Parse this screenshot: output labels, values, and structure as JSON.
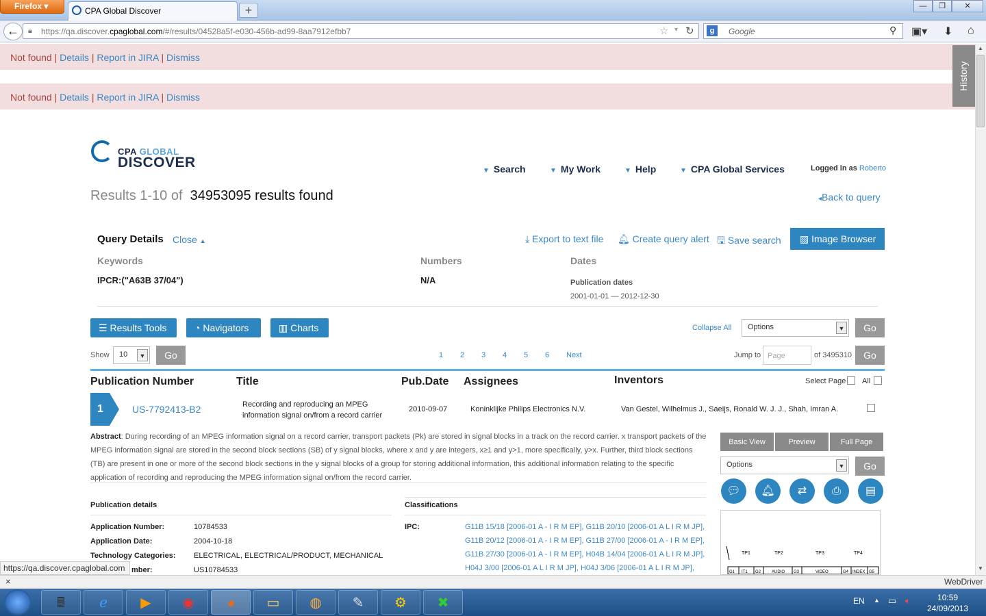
{
  "browser": {
    "menu_label": "Firefox",
    "tab_title": "CPA Global Discover",
    "new_tab": "+",
    "url_prefix": "https://qa.discover.",
    "url_domain": "cpaglobal.com",
    "url_rest": "/#/results/04528a5f-e030-456b-ad99-8aa7912efbb7",
    "search_placeholder": "Google",
    "status_url": "https://qa.discover.cpaglobal.com"
  },
  "alerts": [
    {
      "text": "Not found",
      "details": "Details",
      "jira": "Report in JIRA",
      "dismiss": "Dismiss"
    },
    {
      "text": "Not found",
      "details": "Details",
      "jira": "Report in JIRA",
      "dismiss": "Dismiss"
    }
  ],
  "history_tab": "History",
  "logo": {
    "cpa": "CPA",
    "global": "GLOBAL",
    "discover": "DISCOVER"
  },
  "menu": {
    "search": "Search",
    "mywork": "My Work",
    "help": "Help",
    "services": "CPA Global Services",
    "logged_in": "Logged in as",
    "user": "Roberto"
  },
  "results": {
    "prefix": "Results 1-10 of",
    "count": "34953095 results found",
    "back": "Back to query"
  },
  "query": {
    "title": "Query Details",
    "close": "Close",
    "export": "Export to text file",
    "alert": "Create query alert",
    "save": "Save search",
    "image_browser": "Image Browser",
    "keywords_label": "Keywords",
    "keywords_value": "IPCR:(\"A63B 37/04\")",
    "numbers_label": "Numbers",
    "numbers_value": "N/A",
    "dates_label": "Dates",
    "pubdates_label": "Publication dates",
    "pubdates_value": "2001-01-01 — 2012-12-30"
  },
  "tools": {
    "results_tools": "Results Tools",
    "navigators": "Navigators",
    "charts": "Charts",
    "collapse_all": "Collapse All",
    "options": "Options",
    "go": "Go",
    "show": "Show",
    "show_value": "10",
    "pages": [
      "1",
      "2",
      "3",
      "4",
      "5",
      "6"
    ],
    "next": "Next",
    "jump_to": "Jump to",
    "page_placeholder": "Page",
    "of_pages": "of 3495310"
  },
  "columns": {
    "pubnum": "Publication Number",
    "title": "Title",
    "pubdate": "Pub.Date",
    "assignees": "Assignees",
    "inventors": "Inventors",
    "select_page": "Select Page",
    "all": "All"
  },
  "result": {
    "index": "1",
    "pubnum": "US-7792413-B2",
    "title": "Recording and reproducing an MPEG information signal on/from a record carrier",
    "pubdate": "2010-09-07",
    "assignee": "Koninklijke Philips Electronics N.V.",
    "inventors": "Van Gestel, Wilhelmus J., Saeijs, Ronald W. J. J., Shah, Imran A.",
    "abstract_label": "Abstract",
    "abstract": ": During recording of an MPEG information signal on a record carrier, transport packets (Pk) are stored in signal blocks in a track on the record carrier. x transport packets of the MPEG information signal are stored in the second block sections (SB) of y signal blocks, where x and y are integers, x≥1 and y>1, more specifically, y>x. Further, third block sections (TB) are present in one or more of the second block sections in the y signal blocks of a group for storing additional information, this additional information relating to the specific application of recording and reproducing the MPEG information signal on/from the record carrier.",
    "basic_view": "Basic View",
    "preview": "Preview",
    "full_page": "Full Page",
    "options": "Options",
    "go": "Go",
    "pub_details": "Publication details",
    "classifications": "Classifications",
    "app_number_label": "Application Number:",
    "app_number": "10784533",
    "app_date_label": "Application Date:",
    "app_date": "2004-10-18",
    "tech_label": "Technology Categories:",
    "tech": "ELECTRICAL, ELECTRICAL/PRODUCT, MECHANICAL",
    "num_label": "mber:",
    "num": "US10784533",
    "ipc_label": "IPC:",
    "ipc_lines": [
      "G11B 15/18 [2006-01 A - I R M EP], G11B 20/10 [2006-01 A L I R M JP],",
      "G11B 20/12 [2006-01 A - I R M EP], G11B 27/00 [2006-01 A - I R M EP],",
      "G11B 27/30 [2006-01 A - I R M EP], H04B 14/04 [2006-01 A L I R M JP],",
      "H04J 3/00 [2006-01 A L I R M JP], H04J 3/06 [2006-01 A L I R M JP],"
    ],
    "thumb_labels": [
      "TP1",
      "TP2",
      "TP3",
      "TP4",
      "G1",
      "IT1",
      "G2",
      "AUDIO",
      "G3",
      "VIDEO",
      "G4",
      "INDEX",
      "G5"
    ]
  },
  "webdriver": {
    "close": "×",
    "label": "WebDriver"
  },
  "taskbar": {
    "lang": "EN",
    "time": "10:59",
    "date": "24/09/2013"
  }
}
